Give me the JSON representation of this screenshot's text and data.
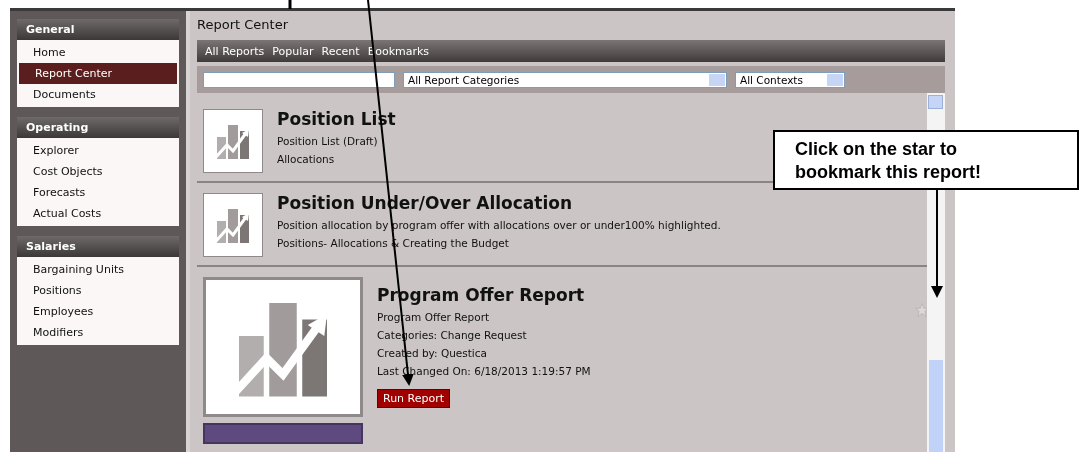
{
  "sidebar": {
    "sections": [
      {
        "title": "General",
        "items": [
          {
            "label": "Home",
            "selected": false
          },
          {
            "label": "Report Center",
            "selected": true
          },
          {
            "label": "Documents",
            "selected": false
          }
        ]
      },
      {
        "title": "Operating",
        "items": [
          {
            "label": "Explorer",
            "selected": false
          },
          {
            "label": "Cost Objects",
            "selected": false
          },
          {
            "label": "Forecasts",
            "selected": false
          },
          {
            "label": "Actual Costs",
            "selected": false
          }
        ]
      },
      {
        "title": "Salaries",
        "items": [
          {
            "label": "Bargaining Units",
            "selected": false
          },
          {
            "label": "Positions",
            "selected": false
          },
          {
            "label": "Employees",
            "selected": false
          },
          {
            "label": "Modifiers",
            "selected": false
          }
        ]
      }
    ]
  },
  "page_title": "Report Center",
  "nav_links": [
    "All Reports",
    "Popular",
    "Recent",
    "Bookmarks"
  ],
  "filters": {
    "category": "All Report Categories",
    "context": "All Contexts"
  },
  "reports": [
    {
      "title": "Position List",
      "lines": [
        "Position List (Draft)",
        "Allocations"
      ],
      "expanded": false
    },
    {
      "title": "Position Under/Over Allocation",
      "lines": [
        "Position allocation by program offer with allocations over or under100% highlighted.",
        "Positions- Allocations & Creating the Budget"
      ],
      "expanded": false
    },
    {
      "title": "Program Offer Report",
      "lines": [
        "Program Offer Report",
        "Categories: Change Request",
        "Created by: Questica",
        "Last Changed On: 6/18/2013 1:19:57 PM"
      ],
      "expanded": true,
      "button": "Run Report"
    }
  ],
  "callout": [
    "Click on the star to",
    "bookmark this report!"
  ]
}
